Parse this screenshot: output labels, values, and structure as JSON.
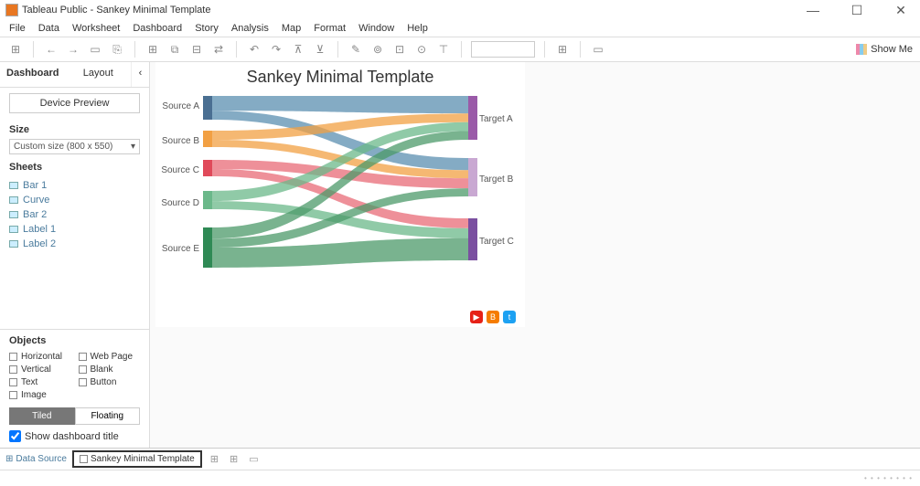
{
  "window": {
    "title": "Tableau Public - Sankey Minimal Template"
  },
  "menu": [
    "File",
    "Data",
    "Worksheet",
    "Dashboard",
    "Story",
    "Analysis",
    "Map",
    "Format",
    "Window",
    "Help"
  ],
  "toolbar": {
    "showme": "Show Me"
  },
  "sidebar": {
    "tabs": {
      "dashboard": "Dashboard",
      "layout": "Layout"
    },
    "device_preview": "Device Preview",
    "size_header": "Size",
    "size_value": "Custom size (800 x 550)",
    "sheets_header": "Sheets",
    "sheets": [
      "Bar 1",
      "Curve",
      "Bar 2",
      "Label 1",
      "Label 2"
    ],
    "objects_header": "Objects",
    "objects": [
      "Horizontal",
      "Web Page",
      "Vertical",
      "Blank",
      "Text",
      "Button",
      "Image"
    ],
    "tiled": "Tiled",
    "floating": "Floating",
    "show_title": "Show dashboard title"
  },
  "dashboard": {
    "title": "Sankey Minimal Template"
  },
  "chart_data": {
    "type": "sankey",
    "sources": [
      "Source A",
      "Source B",
      "Source C",
      "Source D",
      "Source E"
    ],
    "targets": [
      "Target A",
      "Target B",
      "Target C"
    ],
    "links": [
      {
        "source": "Source A",
        "target": "Target A",
        "value": 20,
        "color": "#5b8fb0"
      },
      {
        "source": "Source A",
        "target": "Target B",
        "value": 12,
        "color": "#5b8fb0"
      },
      {
        "source": "Source B",
        "target": "Target A",
        "value": 10,
        "color": "#f2a043"
      },
      {
        "source": "Source B",
        "target": "Target B",
        "value": 8,
        "color": "#f2a043"
      },
      {
        "source": "Source C",
        "target": "Target B",
        "value": 10,
        "color": "#e86b77"
      },
      {
        "source": "Source C",
        "target": "Target C",
        "value": 8,
        "color": "#e86b77"
      },
      {
        "source": "Source D",
        "target": "Target A",
        "value": 10,
        "color": "#6bb88a"
      },
      {
        "source": "Source D",
        "target": "Target C",
        "value": 8,
        "color": "#6bb88a"
      },
      {
        "source": "Source E",
        "target": "Target A",
        "value": 10,
        "color": "#4c9a6a"
      },
      {
        "source": "Source E",
        "target": "Target B",
        "value": 8,
        "color": "#4c9a6a"
      },
      {
        "source": "Source E",
        "target": "Target C",
        "value": 18,
        "color": "#4c9a6a"
      }
    ],
    "source_colors": {
      "Source A": "#4a6f92",
      "Source B": "#f2a043",
      "Source C": "#e04a5a",
      "Source D": "#6bb88a",
      "Source E": "#2f8a55"
    },
    "target_colors": {
      "Target A": "#9a5aa8",
      "Target B": "#c9a8d2",
      "Target C": "#7a4fa0"
    }
  },
  "bottom": {
    "data_source": "Data Source",
    "active_tab": "Sankey Minimal Template"
  }
}
